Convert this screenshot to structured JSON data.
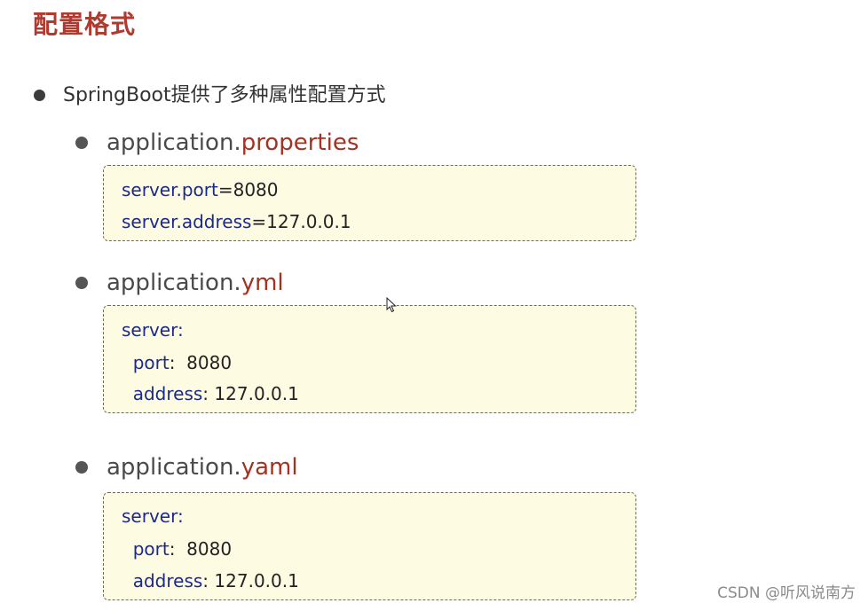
{
  "title": "配置格式",
  "main_bullet": "SpringBoot提供了多种属性配置方式",
  "files": [
    {
      "name": "application.",
      "ext": "properties",
      "lines": [
        {
          "key": "server.port",
          "sep": "=",
          "value": "8080"
        },
        {
          "key": "server.address",
          "sep": "=",
          "value": "127.0.0.1"
        }
      ]
    },
    {
      "name": "application.",
      "ext": "yml",
      "lines": [
        {
          "key": "server:",
          "sep": "",
          "value": ""
        },
        {
          "key": "  port",
          "sep": ":  ",
          "value": "8080"
        },
        {
          "key": "  address",
          "sep": ": ",
          "value": "127.0.0.1"
        }
      ]
    },
    {
      "name": "application.",
      "ext": "yaml",
      "lines": [
        {
          "key": "server:",
          "sep": "",
          "value": ""
        },
        {
          "key": "  port",
          "sep": ":  ",
          "value": "8080"
        },
        {
          "key": "  address",
          "sep": ": ",
          "value": "127.0.0.1"
        }
      ]
    }
  ],
  "watermark": "CSDN @听风说南方",
  "colors": {
    "title": "#b03a2e",
    "ext": "#a33222",
    "key": "#1a2a8c",
    "box_bg": "#fefbe3"
  }
}
